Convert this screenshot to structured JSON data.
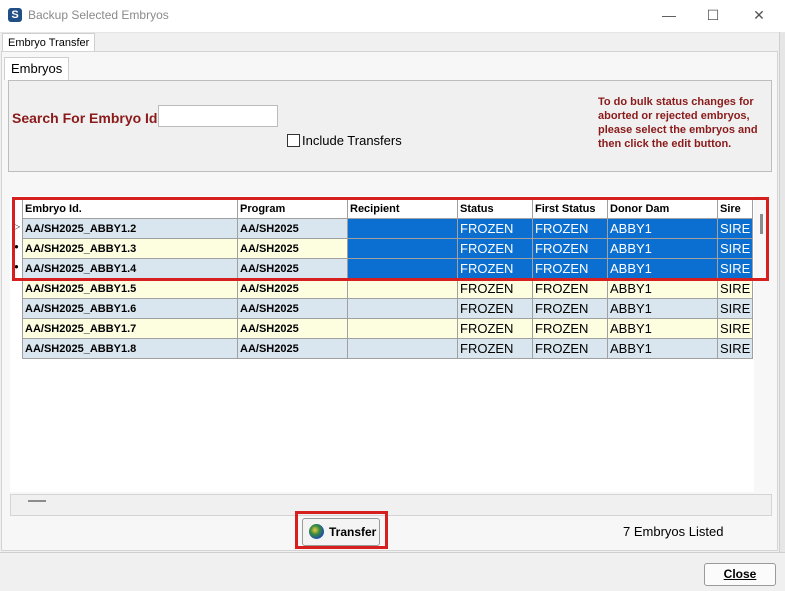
{
  "window": {
    "title": "Backup Selected Embryos",
    "app_icon": "S",
    "minimize": "—",
    "maximize": "☐",
    "close": "✕"
  },
  "outer_tab": "Embryo Transfer",
  "inner_tab": "Embryos",
  "search": {
    "label": "Search For Embryo Id.",
    "value": "",
    "include_transfers_label": "Include Transfers",
    "include_transfers_checked": false
  },
  "info_text": "To do bulk status changes for aborted or rejected embryos, please select the embryos and then click the edit button.",
  "grid": {
    "columns": [
      "Embryo Id.",
      "Program",
      "Recipient",
      "Status",
      "First Status",
      "Donor Dam",
      "Sire"
    ],
    "rows": [
      {
        "embryo_id": "AA/SH2025_ABBY1.2",
        "program": "AA/SH2025",
        "recipient": "",
        "status": "FROZEN",
        "first_status": "FROZEN",
        "donor_dam": "ABBY1",
        "sire": "SIRE",
        "selected": true,
        "marker": "current"
      },
      {
        "embryo_id": "AA/SH2025_ABBY1.3",
        "program": "AA/SH2025",
        "recipient": "",
        "status": "FROZEN",
        "first_status": "FROZEN",
        "donor_dam": "ABBY1",
        "sire": "SIRE",
        "selected": true,
        "marker": "dot"
      },
      {
        "embryo_id": "AA/SH2025_ABBY1.4",
        "program": "AA/SH2025",
        "recipient": "",
        "status": "FROZEN",
        "first_status": "FROZEN",
        "donor_dam": "ABBY1",
        "sire": "SIRE",
        "selected": true,
        "marker": "dot"
      },
      {
        "embryo_id": "AA/SH2025_ABBY1.5",
        "program": "AA/SH2025",
        "recipient": "",
        "status": "FROZEN",
        "first_status": "FROZEN",
        "donor_dam": "ABBY1",
        "sire": "SIRE",
        "selected": false,
        "marker": ""
      },
      {
        "embryo_id": "AA/SH2025_ABBY1.6",
        "program": "AA/SH2025",
        "recipient": "",
        "status": "FROZEN",
        "first_status": "FROZEN",
        "donor_dam": "ABBY1",
        "sire": "SIRE",
        "selected": false,
        "marker": ""
      },
      {
        "embryo_id": "AA/SH2025_ABBY1.7",
        "program": "AA/SH2025",
        "recipient": "",
        "status": "FROZEN",
        "first_status": "FROZEN",
        "donor_dam": "ABBY1",
        "sire": "SIRE",
        "selected": false,
        "marker": ""
      },
      {
        "embryo_id": "AA/SH2025_ABBY1.8",
        "program": "AA/SH2025",
        "recipient": "",
        "status": "FROZEN",
        "first_status": "FROZEN",
        "donor_dam": "ABBY1",
        "sire": "SIRE",
        "selected": false,
        "marker": ""
      }
    ]
  },
  "transfer_button": {
    "label": "Transfer",
    "icon": "globe-icon"
  },
  "count_text": "7 Embryos Listed",
  "close_button": "Close",
  "colors": {
    "selection": "#0a6fd1",
    "highlight": "#d61f1f",
    "label_text": "#8b1a1a"
  }
}
